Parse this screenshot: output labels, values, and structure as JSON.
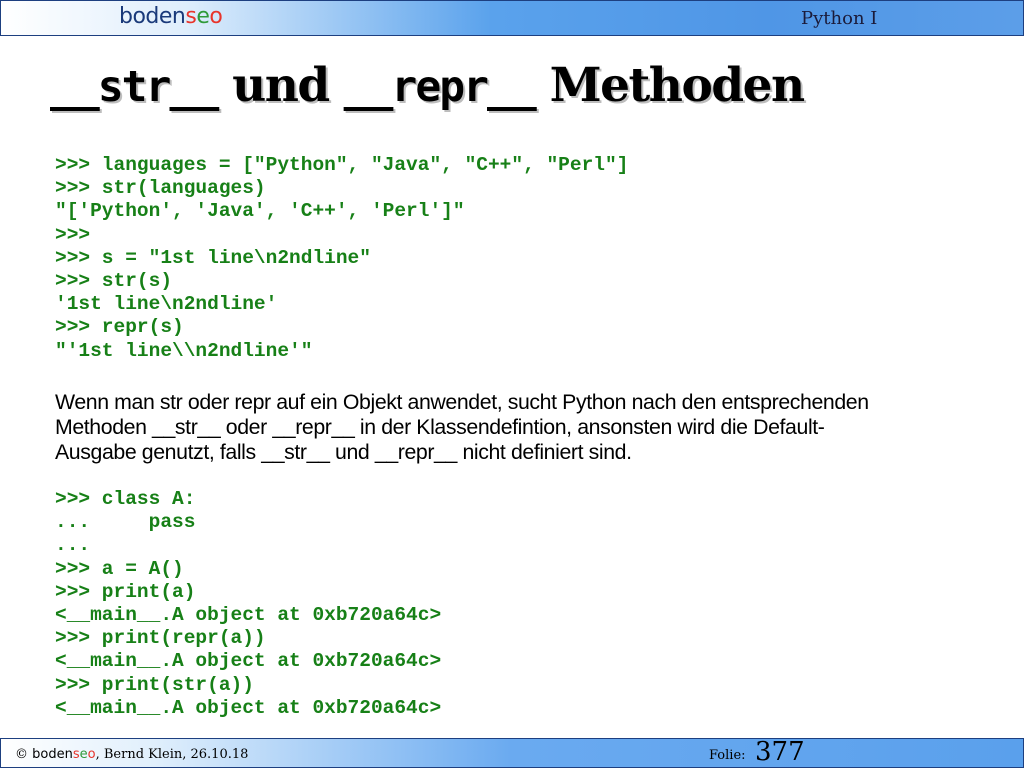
{
  "header": {
    "logo_main": "boden",
    "logo_s": "s",
    "logo_e": "e",
    "logo_o": "o",
    "course": "Python I"
  },
  "title": {
    "part1": "__str__",
    "part2": " und ",
    "part3": "__repr__",
    "part4": " Methoden"
  },
  "code_block_1": [
    ">>> languages = [\"Python\", \"Java\", \"C++\", \"Perl\"]",
    ">>> str(languages)",
    "\"['Python', 'Java', 'C++', 'Perl']\"",
    ">>>",
    ">>> s = \"1st line\\n2ndline\"",
    ">>> str(s)",
    "'1st line\\n2ndline'",
    ">>> repr(s)",
    "\"'1st line\\\\n2ndline'\""
  ],
  "prose": [
    "Wenn man  str oder repr auf ein Objekt anwendet, sucht Python nach den entsprechenden",
    "Methoden __str__ oder __repr__ in der Klassendefintion, ansonsten wird die Default-",
    "Ausgabe genutzt, falls  __str__ und __repr__ nicht definiert sind."
  ],
  "code_block_2": [
    ">>> class A:",
    "...     pass",
    "...",
    ">>> a = A()",
    ">>> print(a)",
    "<__main__.A object at 0xb720a64c>",
    ">>> print(repr(a))",
    "<__main__.A object at 0xb720a64c>",
    ">>> print(str(a))",
    "<__main__.A object at 0xb720a64c>"
  ],
  "footer": {
    "copyright": "© ",
    "logo_main": "boden",
    "logo_s": "s",
    "logo_e": "e",
    "logo_o": "o",
    "author_date": ", Bernd Klein, 26.10.18",
    "folie_label": "Folie:",
    "folie_number": "377"
  },
  "colors": {
    "code": "#178017",
    "header_blue": "#4f96e6",
    "logo_blue": "#1a3a7a",
    "logo_red": "#e8342b",
    "logo_green": "#2f9a3a"
  }
}
